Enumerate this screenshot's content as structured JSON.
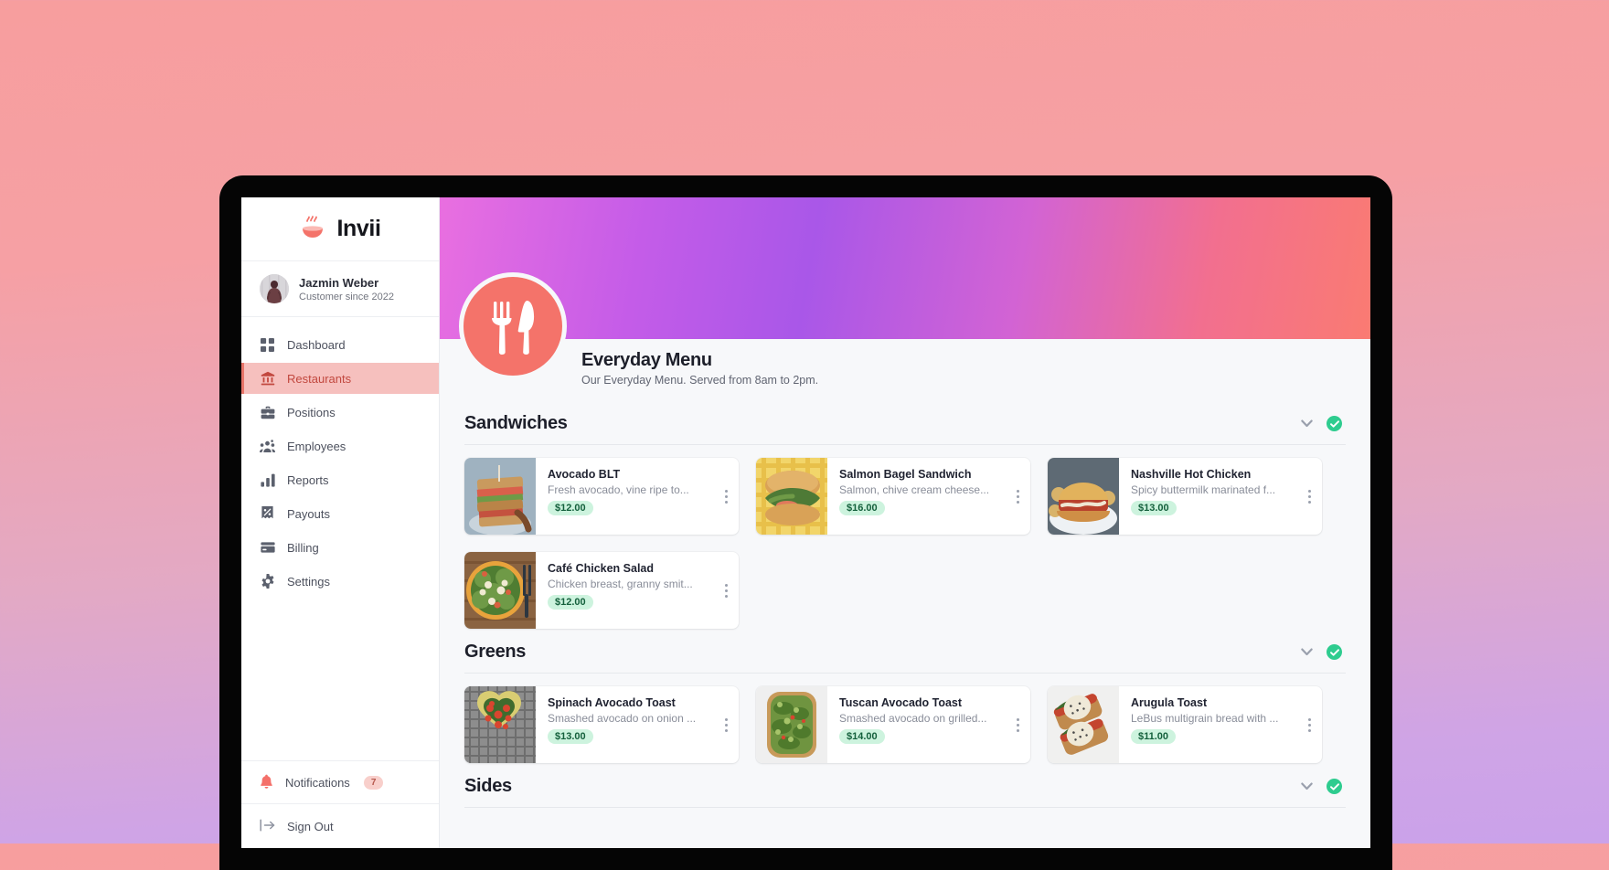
{
  "brand": {
    "name": "Invii",
    "logo_icon": "steaming-bowl-icon"
  },
  "profile": {
    "name": "Jazmin Weber",
    "subtitle": "Customer since 2022",
    "avatar_icon": "user-avatar"
  },
  "sidebar": {
    "items": [
      {
        "label": "Dashboard",
        "icon": "grid-icon",
        "active": false
      },
      {
        "label": "Restaurants",
        "icon": "bank-icon",
        "active": true
      },
      {
        "label": "Positions",
        "icon": "briefcase-icon",
        "active": false
      },
      {
        "label": "Employees",
        "icon": "people-icon",
        "active": false
      },
      {
        "label": "Reports",
        "icon": "bar-chart-icon",
        "active": false
      },
      {
        "label": "Payouts",
        "icon": "percent-tag-icon",
        "active": false
      },
      {
        "label": "Billing",
        "icon": "credit-card-icon",
        "active": false
      },
      {
        "label": "Settings",
        "icon": "gear-icon",
        "active": false
      }
    ],
    "notifications": {
      "label": "Notifications",
      "count": "7",
      "icon": "bell-icon"
    },
    "sign_out": {
      "label": "Sign Out",
      "icon": "sign-out-icon"
    }
  },
  "menu": {
    "title": "Everyday Menu",
    "subtitle": "Our Everyday Menu. Served from 8am to 2pm.",
    "logo_icon": "fork-knife-icon"
  },
  "colors": {
    "accent_red": "#e8756a",
    "active_nav_bg": "#f6c0be",
    "active_nav_text": "#c2483f",
    "price_badge_bg": "#cdf3de",
    "price_badge_text": "#14603c",
    "check_badge_green": "#2ecc8f",
    "hero_gradient_from": "#e96fe0",
    "hero_gradient_to": "#fa7b72",
    "page_bg_from": "#f79e9e",
    "page_bg_to": "#caa2ea"
  },
  "sections": [
    {
      "title": "Sandwiches",
      "collapse_icon": "chevron-down-icon",
      "status_icon": "check-circle-icon",
      "items": [
        {
          "name": "Avocado BLT",
          "desc": "Fresh avocado, vine ripe to...",
          "price": "$12.00",
          "img": "sandwich-photo"
        },
        {
          "name": "Salmon Bagel Sandwich",
          "desc": "Salmon, chive cream cheese...",
          "price": "$16.00",
          "img": "bagel-photo"
        },
        {
          "name": "Nashville Hot Chicken",
          "desc": "Spicy buttermilk marinated f...",
          "price": "$13.00",
          "img": "hot-chicken-photo"
        },
        {
          "name": "Café Chicken Salad",
          "desc": "Chicken breast, granny smit...",
          "price": "$12.00",
          "img": "chicken-salad-photo"
        }
      ]
    },
    {
      "title": "Greens",
      "collapse_icon": "chevron-down-icon",
      "status_icon": "check-circle-icon",
      "items": [
        {
          "name": "Spinach Avocado Toast",
          "desc": "Smashed avocado on onion ...",
          "price": "$13.00",
          "img": "spinach-toast-photo"
        },
        {
          "name": "Tuscan Avocado Toast",
          "desc": "Smashed avocado on grilled...",
          "price": "$14.00",
          "img": "tuscan-toast-photo"
        },
        {
          "name": "Arugula Toast",
          "desc": "LeBus multigrain bread with ...",
          "price": "$11.00",
          "img": "arugula-toast-photo"
        }
      ]
    },
    {
      "title": "Sides",
      "collapse_icon": "chevron-down-icon",
      "status_icon": "check-circle-icon",
      "items": []
    }
  ]
}
